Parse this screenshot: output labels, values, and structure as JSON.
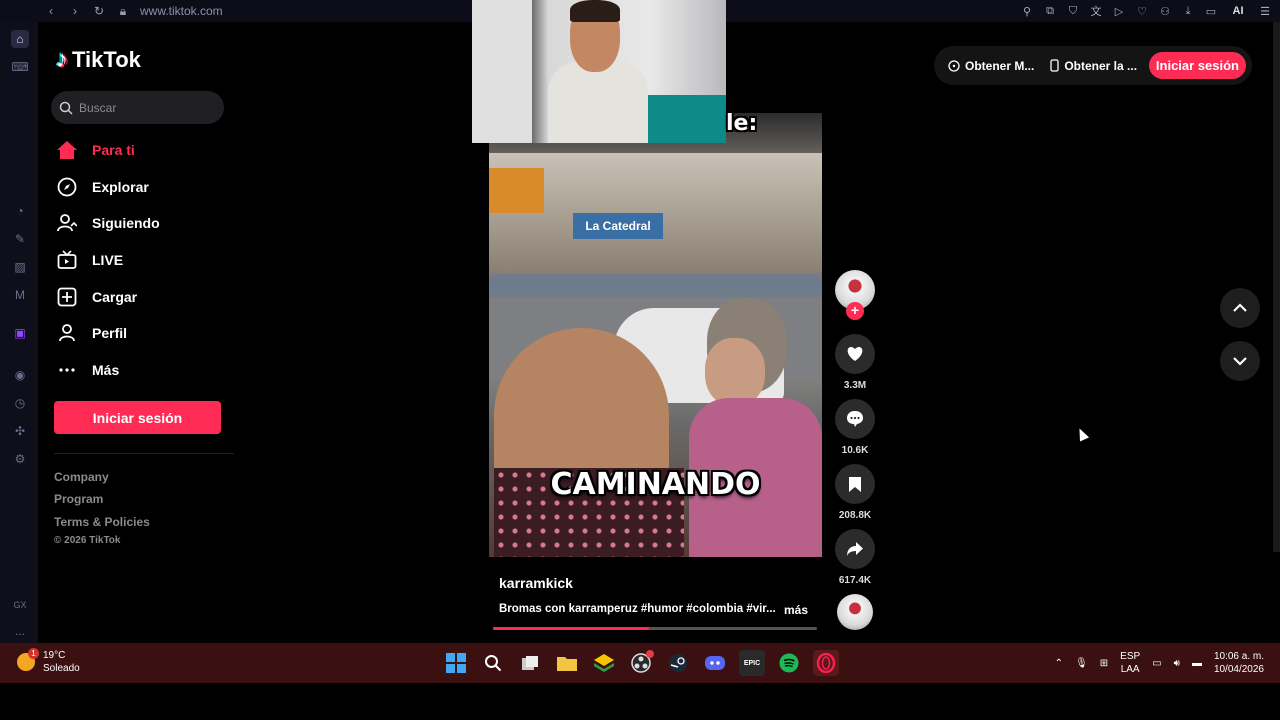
{
  "browser": {
    "url": "www.tiktok.com",
    "ai_label": "AI"
  },
  "opera_sidebar": {
    "gx_label": "GX",
    "more_label": "..."
  },
  "tiktok": {
    "logo_text": "TikTok",
    "search_placeholder": "Buscar",
    "nav": [
      {
        "label": "Para ti",
        "icon": "home-icon",
        "active": true
      },
      {
        "label": "Explorar",
        "icon": "compass-icon"
      },
      {
        "label": "Siguiendo",
        "icon": "following-icon"
      },
      {
        "label": "LIVE",
        "icon": "live-icon"
      },
      {
        "label": "Cargar",
        "icon": "upload-icon"
      },
      {
        "label": "Perfil",
        "icon": "profile-icon"
      },
      {
        "label": "Más",
        "icon": "more-icon"
      }
    ],
    "login_label": "Iniciar sesión",
    "footer": [
      "Company",
      "Program",
      "Terms & Policies",
      "© 2026 TikTok"
    ],
    "accent": "#fe2c55"
  },
  "topright": {
    "item1": "Obtener M...",
    "item2": "Obtener la ...",
    "login": "Iniciar sesión"
  },
  "video": {
    "overlay_word": "le:",
    "caption": "CAMINANDO",
    "store_sign": "La Catedral",
    "author": "karramkick",
    "description": "Bromas con karramperuz #humor #colombia #vir...",
    "more_label": "más",
    "progress": 0.48
  },
  "actions": {
    "likes": "3.3M",
    "comments": "10.6K",
    "saves": "208.8K",
    "shares": "617.4K"
  },
  "taskbar": {
    "temp": "19°C",
    "weather": "Soleado",
    "weather_badge": "1",
    "epic_label": "EPIC",
    "lang1": "ESP",
    "lang2": "LAA",
    "time": "10:06 a. m.",
    "date": "10/04/2026"
  }
}
